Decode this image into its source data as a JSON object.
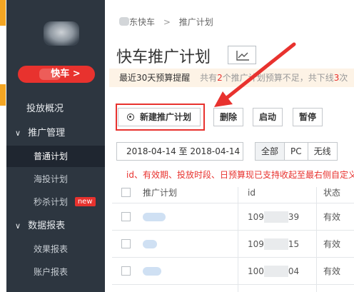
{
  "sidebar": {
    "kuaiche_button": "快车 >",
    "items": [
      {
        "label": "投放概况",
        "type": "top"
      },
      {
        "label": "推广管理",
        "type": "group",
        "chevron": "∨"
      },
      {
        "label": "普通计划",
        "type": "sub",
        "active": true
      },
      {
        "label": "海投计划",
        "type": "sub"
      },
      {
        "label": "秒杀计划",
        "type": "sub",
        "badge": "new"
      },
      {
        "label": "数据报表",
        "type": "group",
        "chevron": "∨"
      },
      {
        "label": "效果报表",
        "type": "sub"
      },
      {
        "label": "账户报表",
        "type": "sub"
      }
    ]
  },
  "header": {
    "breadcrumb_1": "东快车",
    "breadcrumb_sep": ">",
    "breadcrumb_2": "推广计划",
    "title": "快车推广计划"
  },
  "notice": {
    "lead": "最近30天预算提醒",
    "rest_a": "共有",
    "count": "2",
    "rest_b": "个推广计划预算不足，共下线",
    "count2": "3",
    "rest_c": "次"
  },
  "toolbar": {
    "create": "新建推广计划",
    "delete": "删除",
    "start": "启动",
    "pause": "暂停"
  },
  "filters": {
    "date_range": "2018-04-14 至 2018-04-14",
    "options": [
      "全部",
      "PC",
      "无线"
    ],
    "selected": "全部"
  },
  "info_line": "id、有效期、投放时段、日预算现已支持收起至最右侧自定义",
  "table": {
    "columns": [
      "推广计划",
      "id",
      "状态"
    ],
    "rows": [
      {
        "id_prefix": "109",
        "id_suffix": "39",
        "status": "有效"
      },
      {
        "id_prefix": "109",
        "id_suffix": "15",
        "status": "有效"
      },
      {
        "id_prefix": "100",
        "id_suffix": "04",
        "status": "有效"
      }
    ]
  },
  "colors": {
    "sidebar_bg": "#2d3640",
    "accent_red": "#e8322e",
    "notice_bg": "#fdf3e6"
  },
  "icons": {
    "chart_button": "line-chart-icon",
    "create_button": "target-circle-icon"
  }
}
